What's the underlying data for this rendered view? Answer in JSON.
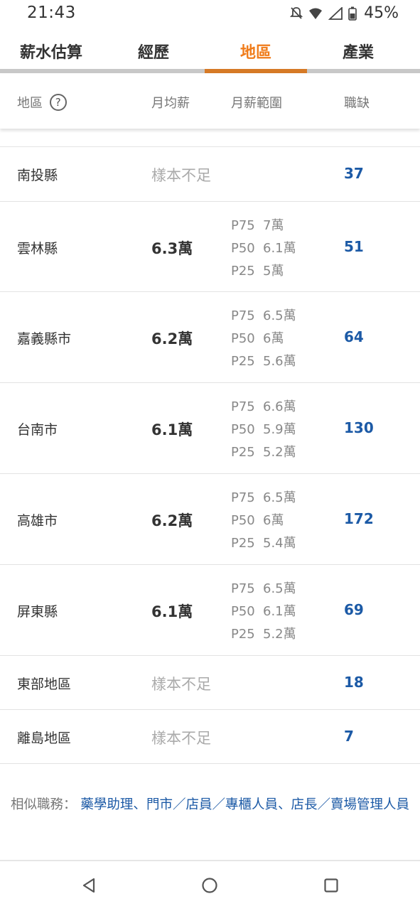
{
  "status_bar": {
    "time": "21:43",
    "battery": "45%"
  },
  "tabs": [
    {
      "label": "薪水估算",
      "active": false
    },
    {
      "label": "經歷",
      "active": false
    },
    {
      "label": "地區",
      "active": true
    },
    {
      "label": "產業",
      "active": false
    }
  ],
  "table_header": {
    "region": "地區",
    "help": "?",
    "avg_salary": "月均薪",
    "salary_range": "月薪範圍",
    "openings": "職缺"
  },
  "rows": [
    {
      "region": "南投縣",
      "insufficient": "樣本不足",
      "openings": "37"
    },
    {
      "region": "雲林縣",
      "avg": "6.3萬",
      "p75_label": "P75",
      "p75": "7萬",
      "p50_label": "P50",
      "p50": "6.1萬",
      "p25_label": "P25",
      "p25": "5萬",
      "openings": "51"
    },
    {
      "region": "嘉義縣市",
      "avg": "6.2萬",
      "p75_label": "P75",
      "p75": "6.5萬",
      "p50_label": "P50",
      "p50": "6萬",
      "p25_label": "P25",
      "p25": "5.6萬",
      "openings": "64"
    },
    {
      "region": "台南市",
      "avg": "6.1萬",
      "p75_label": "P75",
      "p75": "6.6萬",
      "p50_label": "P50",
      "p50": "5.9萬",
      "p25_label": "P25",
      "p25": "5.2萬",
      "openings": "130"
    },
    {
      "region": "高雄市",
      "avg": "6.2萬",
      "p75_label": "P75",
      "p75": "6.5萬",
      "p50_label": "P50",
      "p50": "6萬",
      "p25_label": "P25",
      "p25": "5.4萬",
      "openings": "172"
    },
    {
      "region": "屏東縣",
      "avg": "6.1萬",
      "p75_label": "P75",
      "p75": "6.5萬",
      "p50_label": "P50",
      "p50": "6.1萬",
      "p25_label": "P25",
      "p25": "5.2萬",
      "openings": "69"
    },
    {
      "region": "東部地區",
      "insufficient": "樣本不足",
      "openings": "18"
    },
    {
      "region": "離島地區",
      "insufficient": "樣本不足",
      "openings": "7"
    }
  ],
  "similar_jobs": {
    "label": "相似職務：",
    "items": [
      "藥學助理",
      "門市／店員／專櫃人員",
      "店長／賣場管理人員"
    ],
    "separator": "、"
  },
  "colors": {
    "accent": "#f07c1b",
    "link": "#1c5aa6",
    "indicator": "#d67a26"
  }
}
